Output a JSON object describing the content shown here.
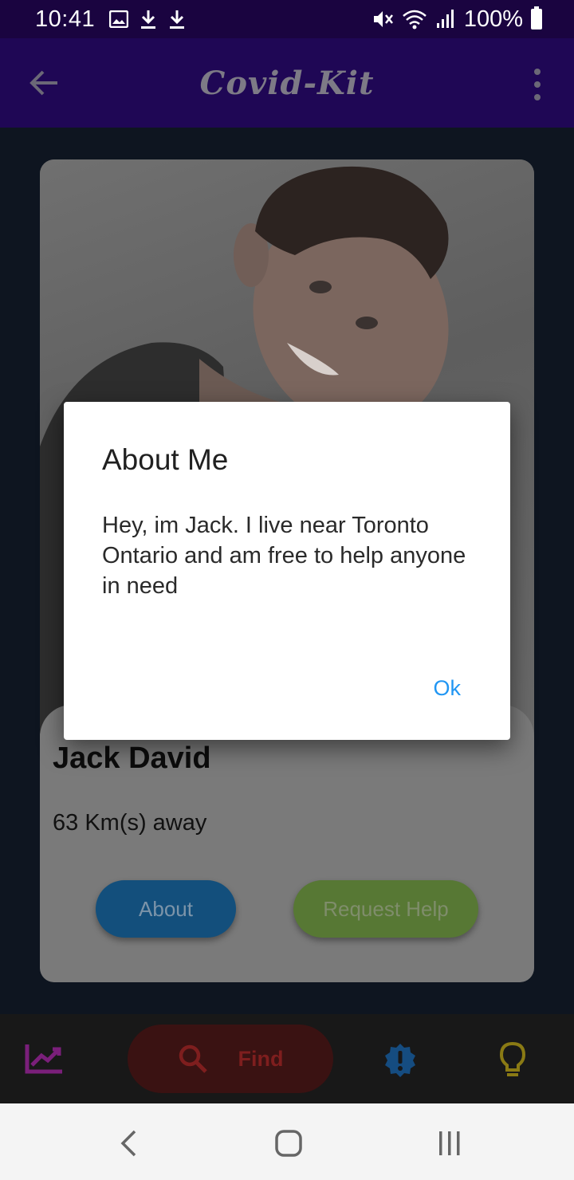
{
  "status_bar": {
    "time": "10:41",
    "battery": "100%"
  },
  "app_bar": {
    "title": "Covid-Kit"
  },
  "profile_card": {
    "name": "Jack David",
    "distance": "63 Km(s) away",
    "about_label": "About",
    "request_help_label": "Request Help"
  },
  "bottom_nav": {
    "items": [
      {
        "icon": "trending-up-icon",
        "color": "#7a1f7a"
      },
      {
        "icon": "search-icon",
        "label": "Find",
        "color": "#7e1e1e"
      },
      {
        "icon": "alert-badge-icon",
        "color": "#154c80"
      },
      {
        "icon": "lightbulb-icon",
        "color": "#8a7a14"
      }
    ]
  },
  "dialog": {
    "title": "About Me",
    "body": "Hey, im Jack. I live near Toronto Ontario and am free to help anyone in need",
    "ok_label": "Ok"
  },
  "colors": {
    "status_bar": "#1a0440",
    "app_bar": "#1f0755",
    "accent_blue": "#2196f3",
    "about_button": "#134f7c",
    "request_help_button": "#577834"
  }
}
